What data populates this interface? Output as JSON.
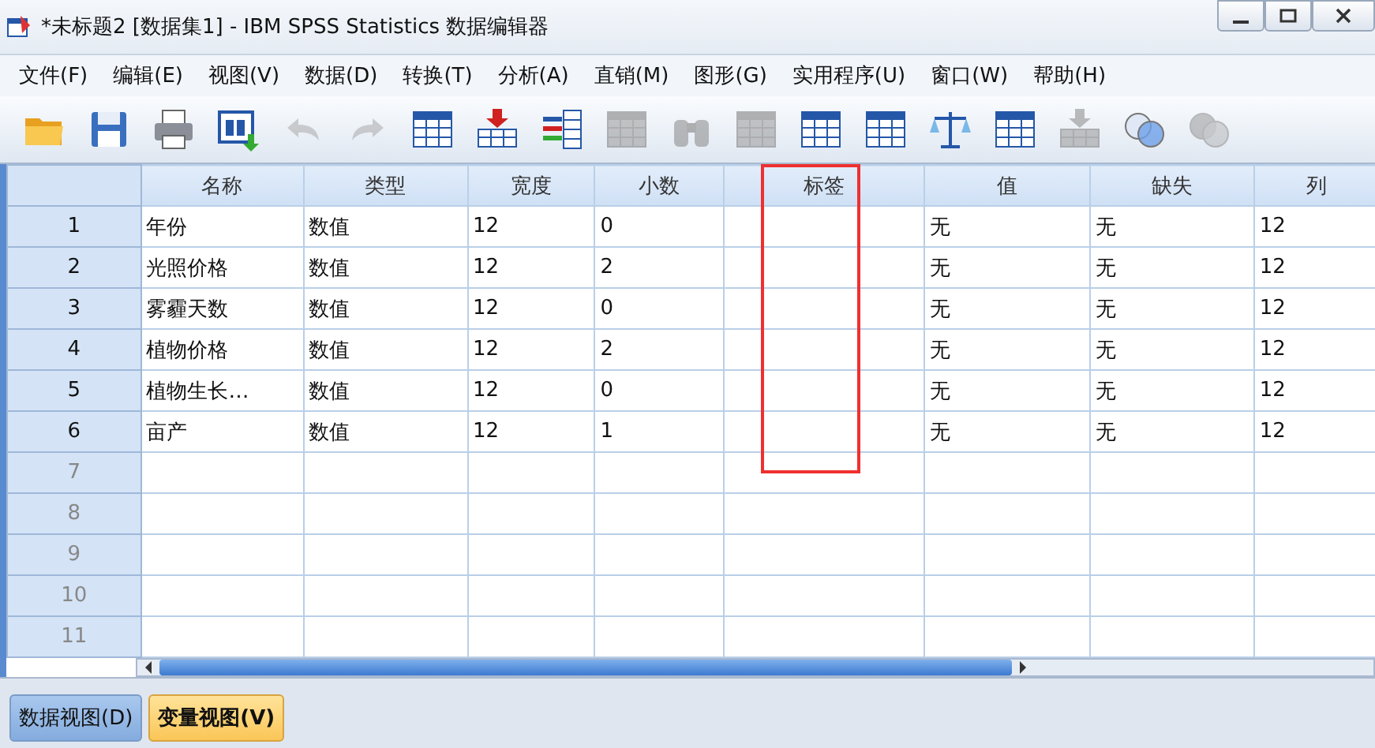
{
  "window": {
    "title": "*未标题2 [数据集1] - IBM SPSS Statistics 数据编辑器"
  },
  "menu": [
    "文件(F)",
    "编辑(E)",
    "视图(V)",
    "数据(D)",
    "转换(T)",
    "分析(A)",
    "直销(M)",
    "图形(G)",
    "实用程序(U)",
    "窗口(W)",
    "帮助(H)"
  ],
  "toolbar": [
    {
      "kind": "folder",
      "disabled": false
    },
    {
      "kind": "disk",
      "disabled": false
    },
    {
      "kind": "printer",
      "disabled": false
    },
    {
      "kind": "window",
      "disabled": false
    },
    {
      "kind": "undo",
      "disabled": true
    },
    {
      "kind": "redo",
      "disabled": true
    },
    {
      "kind": "grid",
      "disabled": false
    },
    {
      "kind": "insert",
      "disabled": false
    },
    {
      "kind": "bars",
      "disabled": false
    },
    {
      "kind": "grid",
      "disabled": true
    },
    {
      "kind": "binoculars",
      "disabled": true
    },
    {
      "kind": "grid",
      "disabled": true
    },
    {
      "kind": "grid",
      "disabled": false
    },
    {
      "kind": "grid",
      "disabled": false
    },
    {
      "kind": "scales",
      "disabled": false
    },
    {
      "kind": "grid",
      "disabled": false
    },
    {
      "kind": "insert",
      "disabled": true
    },
    {
      "kind": "circles",
      "disabled": false
    },
    {
      "kind": "circles",
      "disabled": true
    }
  ],
  "table": {
    "columns": [
      {
        "label": "名称",
        "highlighted": false
      },
      {
        "label": "类型",
        "highlighted": false
      },
      {
        "label": "宽度",
        "highlighted": false
      },
      {
        "label": "小数",
        "highlighted": false
      },
      {
        "label": "标签",
        "highlighted": true
      },
      {
        "label": "值",
        "highlighted": false
      },
      {
        "label": "缺失",
        "highlighted": false
      },
      {
        "label": "列",
        "highlighted": false
      }
    ],
    "rows": [
      {
        "number": "1",
        "cells": [
          "年份",
          "数值",
          "12",
          "0",
          null,
          "无",
          "无",
          "12"
        ]
      },
      {
        "number": "2",
        "cells": [
          "光照价格",
          "数值",
          "12",
          "2",
          null,
          "无",
          "无",
          "12"
        ]
      },
      {
        "number": "3",
        "cells": [
          "雾霾天数",
          "数值",
          "12",
          "0",
          null,
          "无",
          "无",
          "12"
        ]
      },
      {
        "number": "4",
        "cells": [
          "植物价格",
          "数值",
          "12",
          "2",
          null,
          "无",
          "无",
          "12"
        ]
      },
      {
        "number": "5",
        "cells": [
          "植物生长…",
          "数值",
          "12",
          "0",
          null,
          "无",
          "无",
          "12"
        ]
      },
      {
        "number": "6",
        "cells": [
          "亩产",
          "数值",
          "12",
          "1",
          null,
          "无",
          "无",
          "12"
        ]
      },
      {
        "number": "7"
      },
      {
        "number": "8"
      },
      {
        "number": "9"
      },
      {
        "number": "10"
      },
      {
        "number": "11"
      }
    ]
  },
  "tabs": [
    {
      "label": "数据视图(D)",
      "selected": false
    },
    {
      "label": "变量视图(V)",
      "selected": true
    }
  ]
}
